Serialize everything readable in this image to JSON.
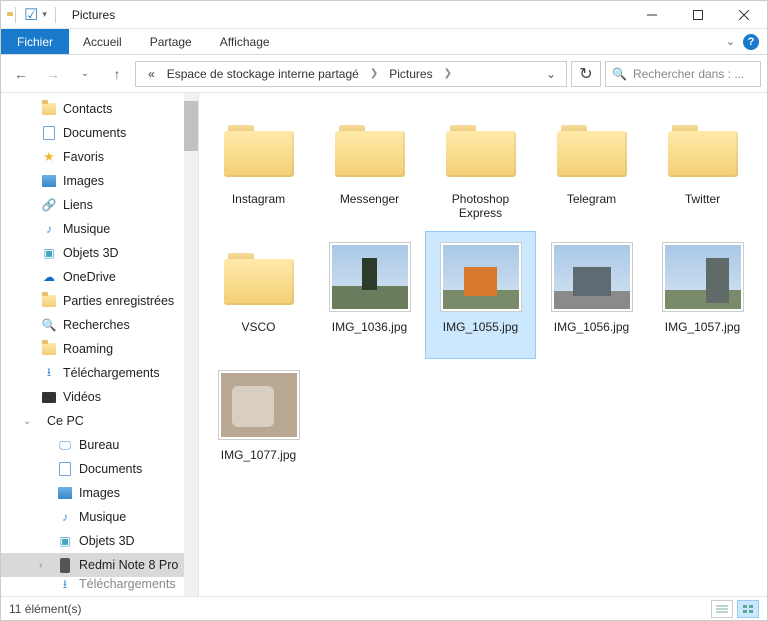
{
  "title": "Pictures",
  "ribbon": {
    "file": "Fichier",
    "tabs": [
      "Accueil",
      "Partage",
      "Affichage"
    ]
  },
  "breadcrumb": {
    "prefix": "«",
    "seg1": "Espace de stockage interne partagé",
    "seg2": "Pictures"
  },
  "search_placeholder": "Rechercher dans : ...",
  "sidebar": {
    "items": [
      {
        "label": "Contacts",
        "icon": "contacts"
      },
      {
        "label": "Documents",
        "icon": "doc"
      },
      {
        "label": "Favoris",
        "icon": "star"
      },
      {
        "label": "Images",
        "icon": "img"
      },
      {
        "label": "Liens",
        "icon": "link"
      },
      {
        "label": "Musique",
        "icon": "music"
      },
      {
        "label": "Objets 3D",
        "icon": "3d"
      },
      {
        "label": "OneDrive",
        "icon": "cloud"
      },
      {
        "label": "Parties enregistrées",
        "icon": "folder"
      },
      {
        "label": "Recherches",
        "icon": "search-y"
      },
      {
        "label": "Roaming",
        "icon": "folder"
      },
      {
        "label": "Téléchargements",
        "icon": "dl"
      },
      {
        "label": "Vidéos",
        "icon": "video"
      }
    ],
    "pc_label": "Ce PC",
    "pc_items": [
      {
        "label": "Bureau",
        "icon": "desk"
      },
      {
        "label": "Documents",
        "icon": "doc"
      },
      {
        "label": "Images",
        "icon": "img"
      },
      {
        "label": "Musique",
        "icon": "music"
      },
      {
        "label": "Objets 3D",
        "icon": "3d"
      },
      {
        "label": "Redmi Note 8 Pro",
        "icon": "phone",
        "selected": true
      },
      {
        "label": "Téléchargements",
        "icon": "dl",
        "cut": true
      }
    ]
  },
  "files": [
    {
      "name": "Instagram",
      "type": "folder"
    },
    {
      "name": "Messenger",
      "type": "folder"
    },
    {
      "name": "Photoshop Express",
      "type": "folder"
    },
    {
      "name": "Telegram",
      "type": "folder"
    },
    {
      "name": "Twitter",
      "type": "folder"
    },
    {
      "name": "VSCO",
      "type": "folder"
    },
    {
      "name": "IMG_1036.jpg",
      "type": "image",
      "thumb": "t1036"
    },
    {
      "name": "IMG_1055.jpg",
      "type": "image",
      "thumb": "t1055",
      "selected": true
    },
    {
      "name": "IMG_1056.jpg",
      "type": "image",
      "thumb": "t1056"
    },
    {
      "name": "IMG_1057.jpg",
      "type": "image",
      "thumb": "t1057"
    },
    {
      "name": "IMG_1077.jpg",
      "type": "image",
      "thumb": "t1077"
    }
  ],
  "status": "11 élément(s)"
}
